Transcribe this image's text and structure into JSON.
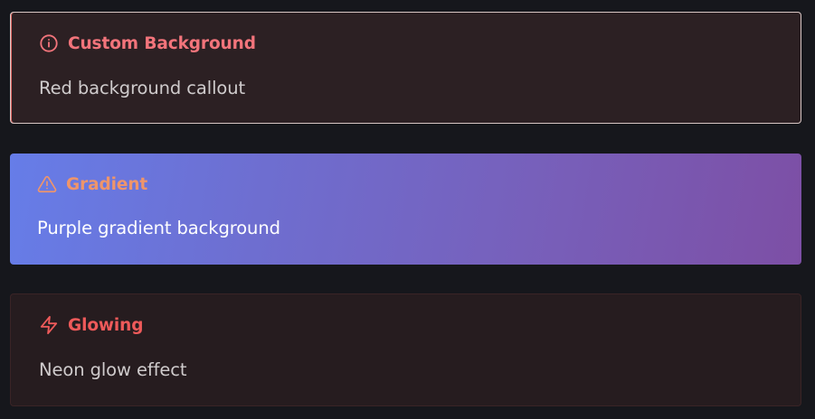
{
  "callouts": [
    {
      "title": "Custom Background",
      "body": "Red background callout",
      "icon": "info-circle-icon",
      "accent": "#f2747b"
    },
    {
      "title": "Gradient",
      "body": "Purple gradient background",
      "icon": "warning-triangle-icon",
      "accent": "#ef956a"
    },
    {
      "title": "Glowing",
      "body": "Neon glow effect",
      "icon": "lightning-bolt-icon",
      "accent": "#ee5a5a"
    }
  ]
}
